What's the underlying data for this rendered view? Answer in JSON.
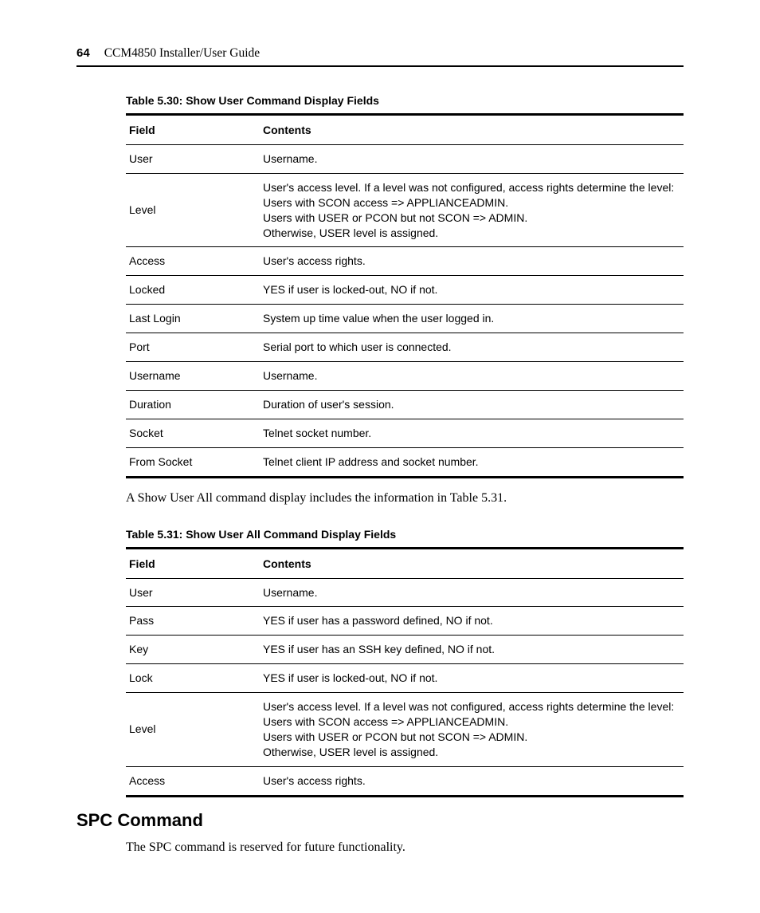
{
  "header": {
    "page_number": "64",
    "guide_title": "CCM4850 Installer/User Guide"
  },
  "table530": {
    "caption": "Table 5.30: Show User Command Display Fields",
    "head": {
      "field": "Field",
      "contents": "Contents"
    },
    "rows": [
      {
        "field": "User",
        "contents": "Username."
      },
      {
        "field": "Level",
        "contents": "User's access level. If a level was not configured, access rights determine the level:\nUsers with SCON access => APPLIANCEADMIN.\nUsers with USER or PCON but not SCON => ADMIN.\nOtherwise, USER level is assigned."
      },
      {
        "field": "Access",
        "contents": "User's access rights."
      },
      {
        "field": "Locked",
        "contents": "YES if user is locked-out, NO if not."
      },
      {
        "field": "Last Login",
        "contents": "System up time value when the user logged in."
      },
      {
        "field": "Port",
        "contents": "Serial port to which user is connected."
      },
      {
        "field": "Username",
        "contents": "Username."
      },
      {
        "field": "Duration",
        "contents": "Duration of user's session."
      },
      {
        "field": "Socket",
        "contents": "Telnet socket number."
      },
      {
        "field": "From Socket",
        "contents": "Telnet client IP address and socket number."
      }
    ]
  },
  "mid_paragraph": "A Show User All command display includes the information in Table 5.31.",
  "table531": {
    "caption": "Table 5.31: Show User All Command Display Fields",
    "head": {
      "field": "Field",
      "contents": "Contents"
    },
    "rows": [
      {
        "field": "User",
        "contents": "Username."
      },
      {
        "field": "Pass",
        "contents": "YES if user has a password defined, NO if not."
      },
      {
        "field": "Key",
        "contents": "YES if user has an SSH key defined, NO if not."
      },
      {
        "field": "Lock",
        "contents": "YES if user is locked-out, NO if not."
      },
      {
        "field": "Level",
        "contents": "User's access level. If a level was not configured, access rights determine the level:\nUsers with SCON access => APPLIANCEADMIN.\nUsers with USER or PCON but not SCON => ADMIN.\nOtherwise, USER level is assigned."
      },
      {
        "field": "Access",
        "contents": "User's access rights."
      }
    ]
  },
  "spc": {
    "heading": "SPC Command",
    "text": "The SPC command is reserved for future functionality."
  }
}
